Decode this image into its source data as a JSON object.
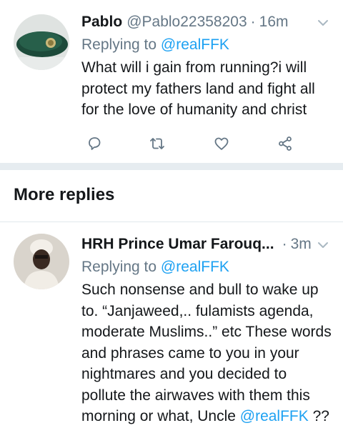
{
  "tweet1": {
    "display_name": "Pablo",
    "handle": "@Pablo22358203",
    "separator": "·",
    "time": "16m",
    "replying_prefix": "Replying to ",
    "replying_handle": "@realFFK",
    "body": "What will i gain from running?i will protect my fathers land and fight all for the love of humanity and christ",
    "actions": [
      "reply-icon",
      "retweet-icon",
      "like-icon",
      "share-icon"
    ]
  },
  "section": {
    "title": "More replies"
  },
  "tweet2": {
    "display_name": "HRH Prince Umar Farouq...",
    "separator": "·",
    "time": "3m",
    "replying_prefix": "Replying to ",
    "replying_handle": "@realFFK",
    "body_main": "Such nonsense and bull to wake up to. “Janjaweed,.. fulamists agenda, moderate Muslims..” etc These words and phrases came to you in your nightmares and you decided to pollute the airwaves with them this morning or what, Uncle ",
    "body_mention": "@realFFK",
    "body_end": " ??"
  },
  "colors": {
    "accent": "#1da1f2",
    "secondary_text": "#657786",
    "primary_text": "#14171a",
    "divider": "#e6ecf0"
  }
}
